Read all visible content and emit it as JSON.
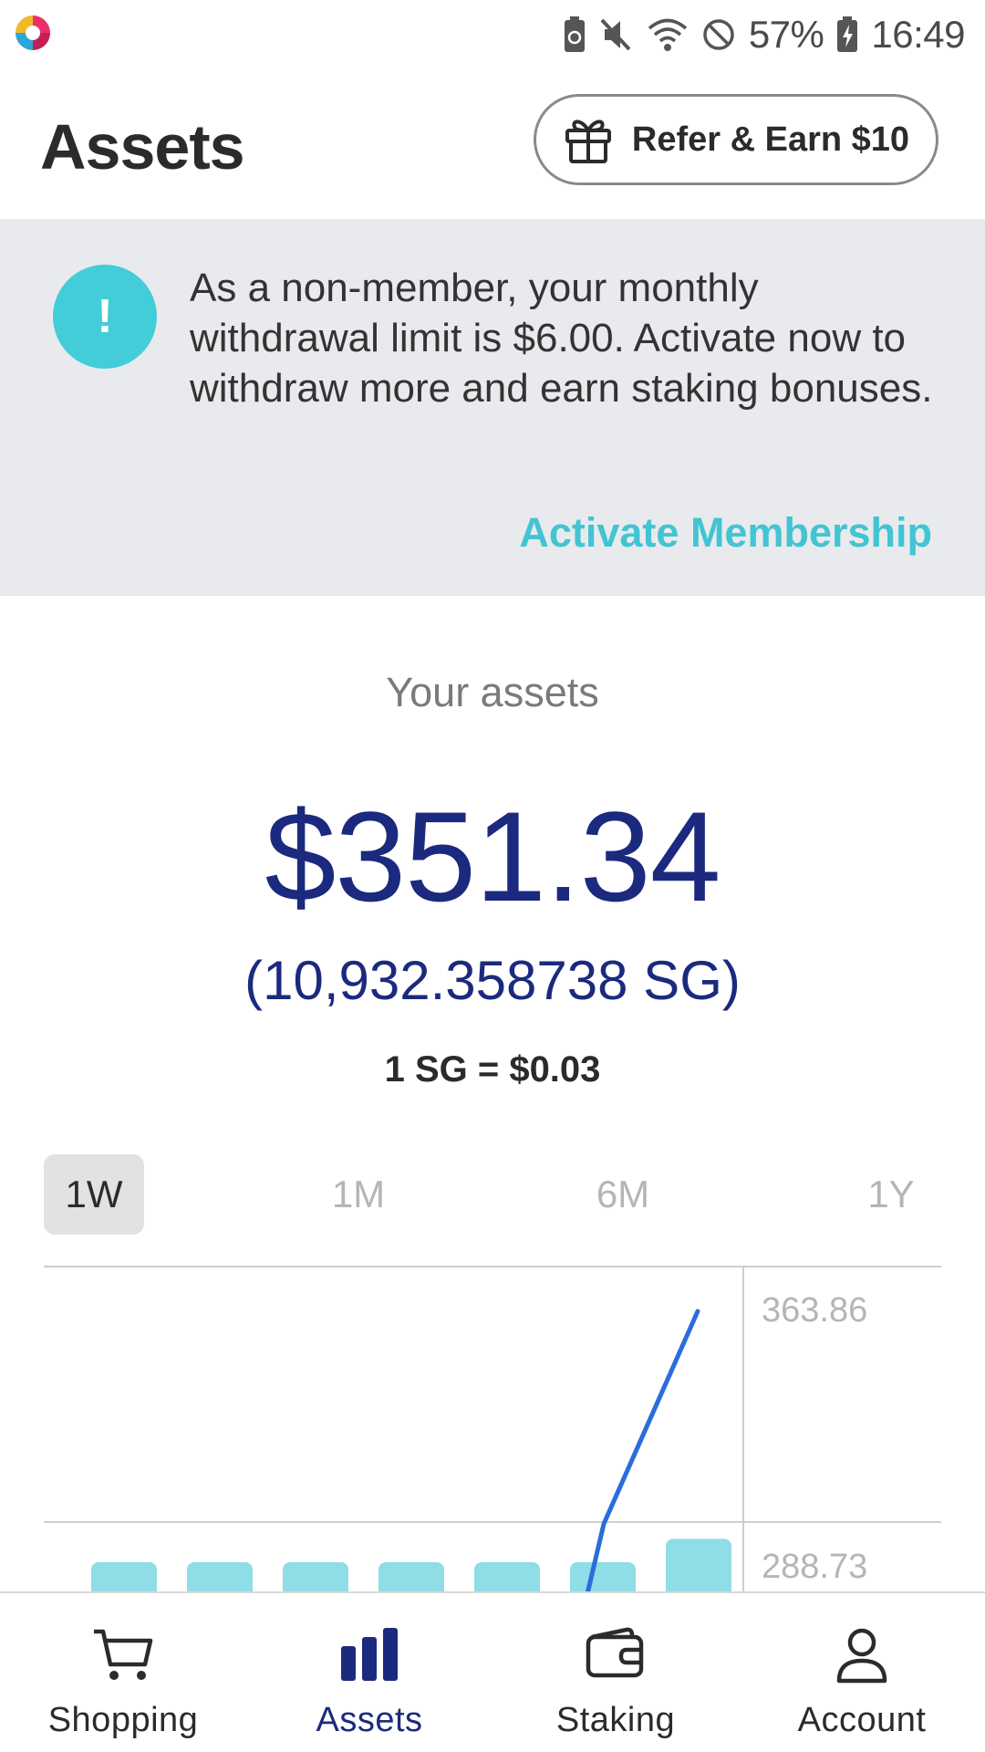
{
  "status_bar": {
    "battery_percent": "57%",
    "time": "16:49",
    "icons": [
      "battery-saver-icon",
      "mute-icon",
      "wifi-icon",
      "do-not-disturb-icon",
      "battery-charging-icon"
    ]
  },
  "header": {
    "title": "Assets",
    "refer_button_label": "Refer & Earn $10"
  },
  "banner": {
    "message": "As a non-member, your monthly withdrawal limit is $6.00. Activate now to withdraw more and earn staking bonuses.",
    "alert_glyph": "!",
    "action_label": "Activate Membership"
  },
  "assets": {
    "heading": "Your assets",
    "value_usd": "$351.34",
    "value_sg": "(10,932.358738 SG)",
    "rate": "1 SG = $0.03"
  },
  "range_tabs": [
    {
      "label": "1W",
      "active": true
    },
    {
      "label": "1M",
      "active": false
    },
    {
      "label": "6M",
      "active": false
    },
    {
      "label": "1Y",
      "active": false
    }
  ],
  "chart_data": {
    "type": "line",
    "y_tick_labels": [
      "363.86",
      "288.73"
    ],
    "line_values": [
      220,
      288.73,
      363.86
    ],
    "bar_values": [
      1,
      1,
      1,
      1,
      1,
      1,
      1.8
    ],
    "line_color": "#2a6ddb",
    "bar_color": "#8fdde6"
  },
  "bottom_nav": [
    {
      "label": "Shopping",
      "icon": "cart-icon",
      "active": false
    },
    {
      "label": "Assets",
      "icon": "bar-chart-icon",
      "active": true
    },
    {
      "label": "Staking",
      "icon": "wallet-icon",
      "active": false
    },
    {
      "label": "Account",
      "icon": "person-icon",
      "active": false
    }
  ],
  "colors": {
    "primary_navy": "#1b2a7e",
    "accent_teal": "#42cdd8",
    "banner_bg": "#e9eaed"
  }
}
